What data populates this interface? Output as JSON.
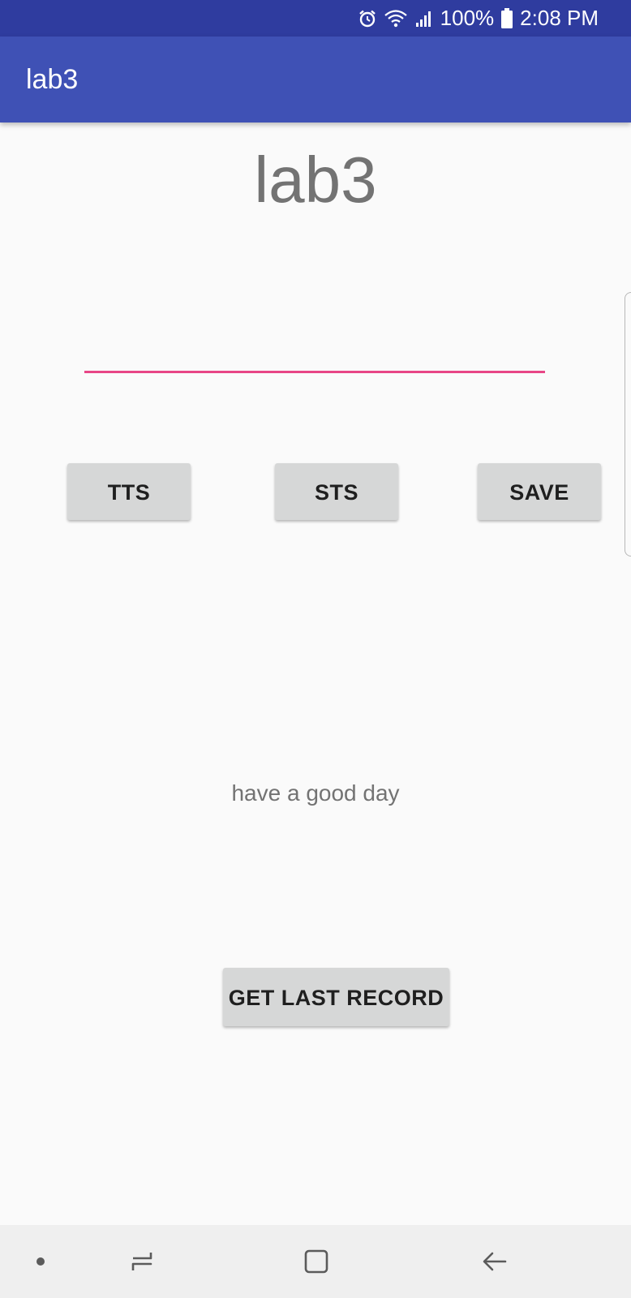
{
  "status_bar": {
    "battery_percent": "100%",
    "time": "2:08 PM",
    "icons": [
      "alarm-icon",
      "wifi-icon",
      "signal-icon",
      "battery-icon"
    ]
  },
  "app_bar": {
    "title": "lab3"
  },
  "main": {
    "heading": "lab3",
    "input": {
      "value": "",
      "placeholder": ""
    },
    "buttons": {
      "tts": "TTS",
      "sts": "STS",
      "save": "SAVE",
      "get_last_record": "GET LAST RECORD"
    },
    "message": "have a good day"
  },
  "nav_bar": {
    "icons": [
      "dot-icon",
      "recent-apps-icon",
      "home-icon",
      "back-icon"
    ]
  },
  "colors": {
    "status_bar": "#2f3c9f",
    "app_bar": "#3f51b5",
    "input_underline": "#e84686",
    "button_bg": "#d6d7d7",
    "background": "#fafafa",
    "nav_bar": "#efefef"
  }
}
